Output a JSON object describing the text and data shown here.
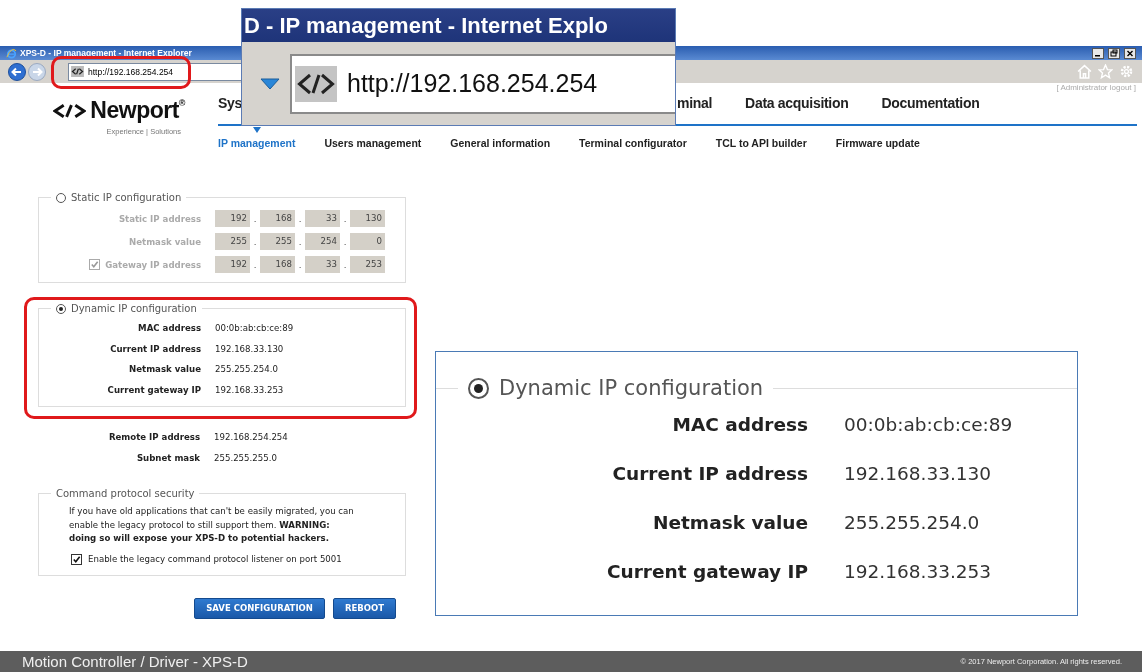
{
  "browser": {
    "title": "XPS-D - IP management - Internet Explorer",
    "url": "http://192.168.254.254"
  },
  "header": {
    "logo": "Newport$^{®}$",
    "tagline": "Experience | Solutions",
    "logout": "[ Administrator logout ]"
  },
  "main_nav": [
    {
      "label": "Sys"
    },
    {
      "label": "minal"
    },
    {
      "label": "Data acquisition"
    },
    {
      "label": "Documentation"
    }
  ],
  "sub_nav": [
    {
      "label": "IP management",
      "selected": true
    },
    {
      "label": "Users management",
      "selected": false
    },
    {
      "label": "General information",
      "selected": false
    },
    {
      "label": "Terminal configurator",
      "selected": false
    },
    {
      "label": "TCL to API builder",
      "selected": false
    },
    {
      "label": "Firmware update",
      "selected": false
    }
  ],
  "static_ip": {
    "legend": "Static IP configuration",
    "selected": false,
    "separator": ".",
    "rows": [
      {
        "kind": "plain",
        "label": "Static IP address",
        "octets": [
          "192",
          "168",
          "33",
          "130"
        ]
      },
      {
        "kind": "plain",
        "label": "Netmask value",
        "octets": [
          "255",
          "255",
          "254",
          "0"
        ]
      },
      {
        "kind": "checkbox",
        "checked": true,
        "label": "Gateway IP address",
        "octets": [
          "192",
          "168",
          "33",
          "253"
        ]
      }
    ]
  },
  "dynamic_ip": {
    "legend": "Dynamic IP configuration",
    "selected": true,
    "rows": [
      {
        "label": "MAC address",
        "value": "00:0b:ab:cb:ce:89"
      },
      {
        "label": "Current IP address",
        "value": "192.168.33.130"
      },
      {
        "label": "Netmask value",
        "value": "255.255.254.0"
      },
      {
        "label": "Current gateway IP",
        "value": "192.168.33.253"
      }
    ]
  },
  "remote": [
    {
      "label": "Remote IP address",
      "value": "192.168.254.254"
    },
    {
      "label": "Subnet mask",
      "value": "255.255.255.0"
    }
  ],
  "security": {
    "legend": "Command protocol security",
    "text": "If you have old applications that can't be easily migrated, you can enable the legacy protocol to still support them. **WARNING: doing so will expose your XPS-D to potential hackers.**",
    "option": {
      "label": "Enable the legacy command protocol listener on port 5001",
      "checked": true
    }
  },
  "buttons": [
    "SAVE CONFIGURATION",
    "REBOOT"
  ],
  "footer": {
    "title": "Motion Controller / Driver - XPS-D",
    "copyright": "© 2017 Newport Corporation. All rights reserved."
  },
  "callouts": {
    "title_zoom": {
      "title": "D - IP management - Internet Explo",
      "url": "http://192.168.254.254"
    },
    "section_zoom": {
      "legend": "Dynamic IP configuration",
      "selected": true,
      "rows": [
        {
          "label": "MAC address",
          "value": "00:0b:ab:cb:ce:89"
        },
        {
          "label": "Current IP address",
          "value": "192.168.33.130"
        },
        {
          "label": "Netmask value",
          "value": "255.255.254.0"
        },
        {
          "label": "Current gateway IP",
          "value": "192.168.33.253"
        }
      ]
    }
  }
}
